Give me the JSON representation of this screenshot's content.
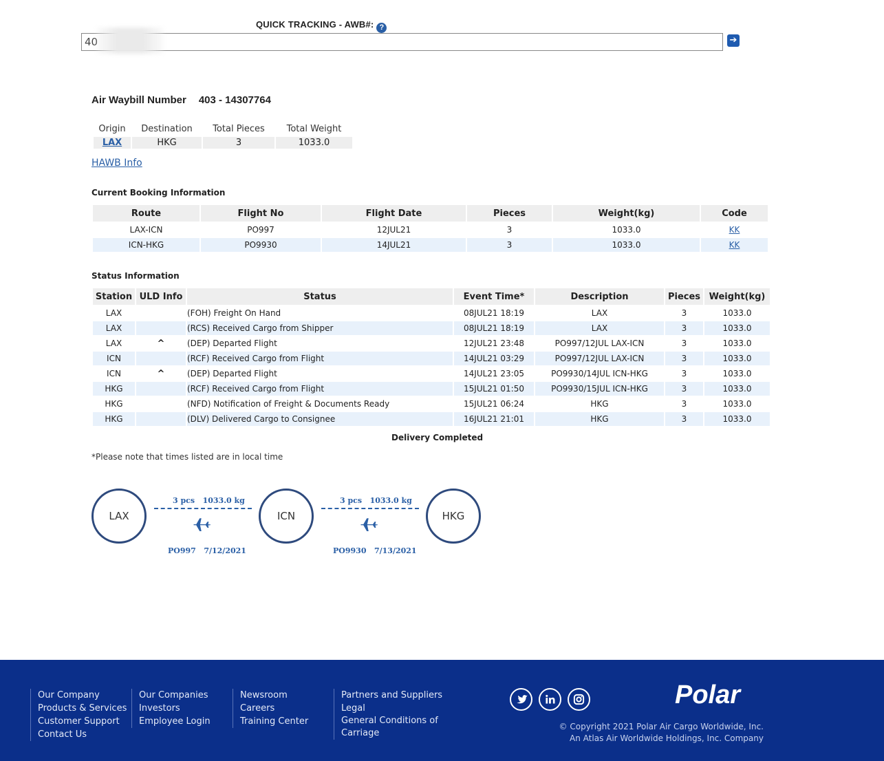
{
  "quick_tracking": {
    "label": "QUICK TRACKING - AWB#:",
    "help": "?",
    "input_value": "40",
    "go": "➔"
  },
  "awb": {
    "label": "Air Waybill Number",
    "number": "403 - 14307764"
  },
  "summary": {
    "headers": [
      "Origin",
      "Destination",
      "Total Pieces",
      "Total Weight"
    ],
    "origin": "LAX",
    "destination": "HKG",
    "total_pieces": "3",
    "total_weight": "1033.0"
  },
  "hawb_link": "HAWB Info",
  "booking": {
    "title": "Current Booking Information",
    "headers": [
      "Route",
      "Flight No",
      "Flight Date",
      "Pieces",
      "Weight(kg)",
      "Code"
    ],
    "rows": [
      [
        "LAX-ICN",
        "PO997",
        "12JUL21",
        "3",
        "1033.0",
        "KK"
      ],
      [
        "ICN-HKG",
        "PO9930",
        "14JUL21",
        "3",
        "1033.0",
        "KK"
      ]
    ]
  },
  "status": {
    "title": "Status Information",
    "headers": [
      "Station",
      "ULD Info",
      "Status",
      "Event Time*",
      "Description",
      "Pieces",
      "Weight(kg)"
    ],
    "rows": [
      [
        "LAX",
        "",
        "(FOH) Freight On Hand",
        "08JUL21 18:19",
        "LAX",
        "3",
        "1033.0"
      ],
      [
        "LAX",
        "",
        "(RCS) Received Cargo from Shipper",
        "08JUL21 18:19",
        "LAX",
        "3",
        "1033.0"
      ],
      [
        "LAX",
        "^",
        "(DEP) Departed Flight",
        "12JUL21 23:48",
        "PO997/12JUL LAX-ICN",
        "3",
        "1033.0"
      ],
      [
        "ICN",
        "",
        "(RCF) Received Cargo from Flight",
        "14JUL21 03:29",
        "PO997/12JUL LAX-ICN",
        "3",
        "1033.0"
      ],
      [
        "ICN",
        "^",
        "(DEP) Departed Flight",
        "14JUL21 23:05",
        "PO9930/14JUL ICN-HKG",
        "3",
        "1033.0"
      ],
      [
        "HKG",
        "",
        "(RCF) Received Cargo from Flight",
        "15JUL21 01:50",
        "PO9930/15JUL ICN-HKG",
        "3",
        "1033.0"
      ],
      [
        "HKG",
        "",
        "(NFD) Notification of Freight & Documents Ready",
        "15JUL21 06:24",
        "HKG",
        "3",
        "1033.0"
      ],
      [
        "HKG",
        "",
        "(DLV) Delivered Cargo to Consignee",
        "16JUL21 21:01",
        "HKG",
        "3",
        "1033.0"
      ]
    ],
    "delivered": "Delivery Completed",
    "note": "*Please note that times listed are in local time"
  },
  "route": {
    "stations": [
      "LAX",
      "ICN",
      "HKG"
    ],
    "legs": [
      {
        "pcs": "3 pcs",
        "kg": "1033.0 kg",
        "flight": "PO997",
        "date": "7/12/2021"
      },
      {
        "pcs": "3 pcs",
        "kg": "1033.0 kg",
        "flight": "PO9930",
        "date": "7/13/2021"
      }
    ]
  },
  "footer": {
    "col1": [
      "Our Company",
      "Products & Services",
      "Customer Support",
      "Contact Us"
    ],
    "col2": [
      "Our Companies",
      "Investors",
      "Employee Login"
    ],
    "col3": [
      "Newsroom",
      "Careers",
      "Training Center"
    ],
    "col4": [
      "Partners and Suppliers",
      "Legal",
      "General Conditions of",
      "Carriage"
    ],
    "social": [
      "twitter-icon",
      "linkedin-icon",
      "instagram-icon"
    ],
    "logo": "Polar",
    "copyright": "© Copyright 2021 Polar Air Cargo Worldwide, Inc.",
    "tagline": "An Atlas Air Worldwide Holdings, Inc. Company"
  },
  "colors": {
    "accent": "#2a5fa6",
    "footer_bg": "#0b2f8a",
    "alt_row": "#e8f1fb",
    "header_bg": "#eeeeee"
  }
}
